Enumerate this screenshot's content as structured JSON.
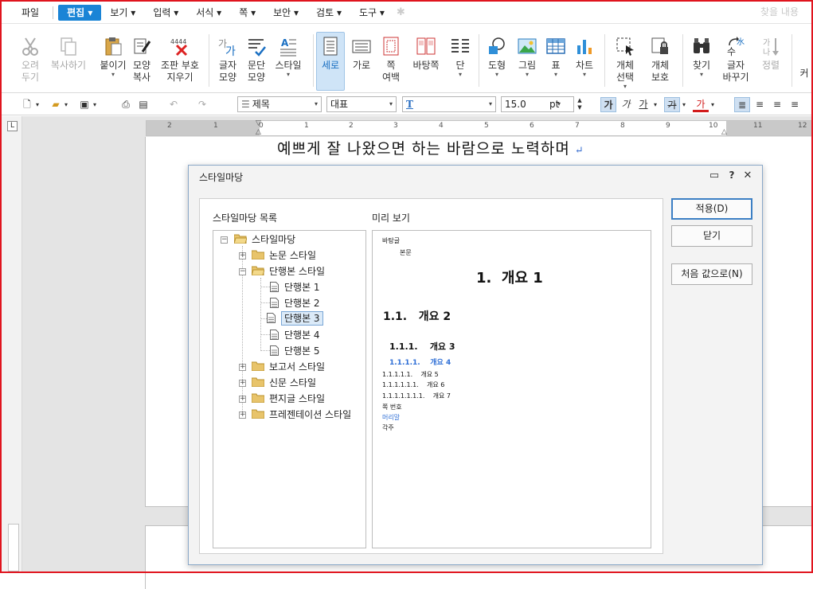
{
  "menubar": {
    "items": [
      "파일",
      "편집",
      "보기",
      "입력",
      "서식",
      "쪽",
      "보안",
      "검토",
      "도구"
    ],
    "active_index": 1,
    "search_placeholder": "찾을 내용"
  },
  "ribbon": {
    "cut": "오려\n두기",
    "copy": "복사하기",
    "paste": "붙이기",
    "format_copy": "모양\n복사",
    "typeset_code": "조판 부호\n지우기",
    "char_shape": "글자\n모양",
    "para_shape": "문단\n모양",
    "style": "스타일",
    "portrait": "세로",
    "landscape": "가로",
    "page_margin": "쪽\n여백",
    "master_page": "바탕쪽",
    "columns": "단",
    "shape": "도형",
    "picture": "그림",
    "table": "표",
    "chart": "차트",
    "object_select": "개체\n선택",
    "object_protect": "개체\n보호",
    "find": "찾기",
    "replace": "글자\n바꾸기",
    "sort": "정렬",
    "overflow": "커"
  },
  "format_bar": {
    "style_name": "제목",
    "font_lang": "대표",
    "font_name": "T",
    "font_size": "15.0",
    "size_unit": "pt",
    "bold_char": "가",
    "italic_char": "가",
    "underline_char": "가",
    "strike_char": "가",
    "color_char": "가",
    "accent_color": "#d21b1b"
  },
  "ruler": {
    "numbers": [
      "2",
      "1",
      "0",
      "1",
      "2",
      "3",
      "4",
      "5",
      "6",
      "7",
      "8",
      "9",
      "10",
      "11",
      "12"
    ]
  },
  "document": {
    "line": "예쁘게 잘 나왔으면 하는 바람으로 노력하며",
    "para_mark": "↵"
  },
  "dialog": {
    "title": "스타일마당",
    "list_label": "스타일마당 목록",
    "preview_label": "미리 보기",
    "tree": {
      "root": "스타일마당",
      "groups": [
        {
          "label": "논문 스타일",
          "expanded": false
        },
        {
          "label": "단행본 스타일",
          "expanded": true,
          "children": [
            "단행본 1",
            "단행본 2",
            "단행본 3",
            "단행본 4",
            "단행본 5"
          ],
          "selected_child": 2
        },
        {
          "label": "보고서 스타일",
          "expanded": false
        },
        {
          "label": "신문 스타일",
          "expanded": false
        },
        {
          "label": "편지글 스타일",
          "expanded": false
        },
        {
          "label": "프레젠테이션 스타일",
          "expanded": false
        }
      ]
    },
    "preview": {
      "base": "바탕글",
      "body": "본문",
      "h1": "1.  개요 1",
      "h2": "1.1.   개요 2",
      "h3": "1.1.1.    개요 3",
      "h4": "1.1.1.1.    개요 4",
      "h5": "1.1.1.1.1.    개요 5",
      "h6": "1.1.1.1.1.1.    개요 6",
      "h7": "1.1.1.1.1.1.1.    개요 7",
      "page_num": "쪽 번호",
      "header": "머리말",
      "footnote": "각주",
      "h4_color": "#2f6fd6"
    },
    "buttons": {
      "apply": "적용(D)",
      "close": "닫기",
      "reset": "처음 값으로(N)"
    }
  }
}
